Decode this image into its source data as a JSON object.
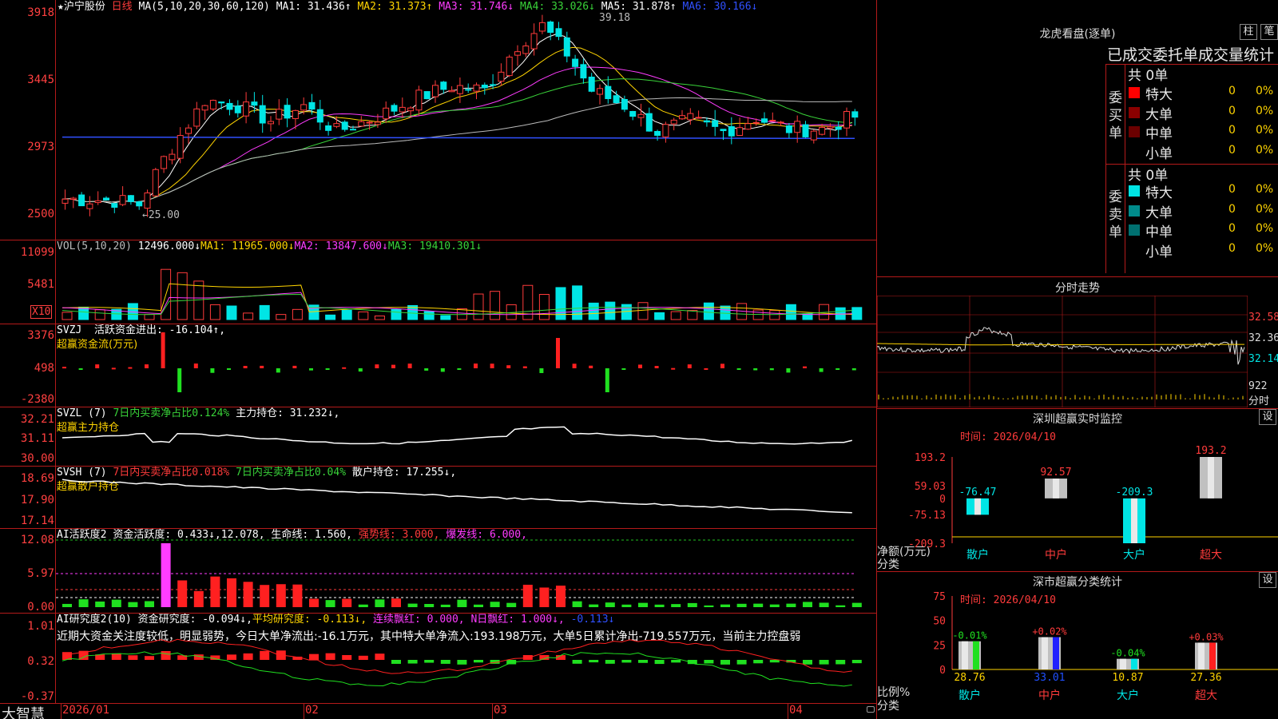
{
  "app": {
    "brand": "大智慧"
  },
  "stock": {
    "name": "沪宁股份",
    "period": "日线"
  },
  "main": {
    "ma_text": "MA(5,10,20,30,60,120)",
    "ma1": "MA1: 31.436↑",
    "ma2": "MA2: 31.373↑",
    "ma3": "MA3: 31.746↓",
    "ma4": "MA4: 33.026↓",
    "ma5": "MA5: 31.878↑",
    "ma6": "MA6: 30.166↓",
    "y_labels": [
      "3918",
      "3445",
      "2973",
      "2500"
    ],
    "high_mark": "39.18",
    "low_mark": "←25.00"
  },
  "vol": {
    "head": "VOL(5,10,20)",
    "val": "12496.000↓",
    "ma1": "MA1: 11965.000↓",
    "ma2": "MA2: 13847.600↓",
    "ma3": "MA3: 19410.301↓",
    "y_labels": [
      "11099",
      "5481"
    ],
    "unit": "X10"
  },
  "svzj": {
    "head": "SVZJ",
    "text": "活跃资金进出: -16.104↑,",
    "sub": "超赢资金流(万元)",
    "y_labels": [
      "3376",
      "498",
      "-2380"
    ]
  },
  "svzl": {
    "head": "SVZL (7)",
    "ratio": "7日内买卖净占比0.124%",
    "hold": "主力持仓: 31.232↓,",
    "sub": "超赢主力持仓",
    "y_labels": [
      "32.21",
      "31.11",
      "30.00"
    ]
  },
  "svsh": {
    "head": "SVSH (7)",
    "ratio1": "7日内买卖净占比0.018%",
    "ratio2": "7日内买卖净占比0.04%",
    "hold": "散户持仓: 17.255↓,",
    "sub": "超赢散户持仓",
    "y_labels": [
      "18.69",
      "17.90",
      "17.14"
    ]
  },
  "ai1": {
    "head": "AI活跃度2",
    "active": "资金活跃度: 0.433↓,",
    "v2": "12.078,",
    "life": "生命线: 1.560,",
    "strong": "强势线: 3.000,",
    "burst": "爆发线: 6.000,",
    "y_labels": [
      "12.08",
      "5.97",
      "0.00"
    ]
  },
  "ai2": {
    "head": "AI研究度2(10)",
    "research": "资金研究度: -0.094↓,",
    "avg": "平均研究度: -0.113↓,",
    "cont": "连续飘红: 0.000,",
    "nday": "N日飘红: 1.000↓,",
    "last": "-0.113↓",
    "summary": "近期大资金关注度较低，明显弱势，今日大单净流出:-16.1万元，其中特大单净流入:193.198万元，大单5日累计净出-719.557万元，当前主力控盘弱",
    "y_labels": [
      "1.01",
      "0.32",
      "-0.37"
    ]
  },
  "dates": [
    "2026/01",
    "02",
    "03",
    "04"
  ],
  "lhb": {
    "title": "龙虎看盘(逐单)",
    "btn1": "柱",
    "btn2": "笔",
    "subtitle": "已成交委托单成交量统计",
    "buy_side": "委买单",
    "sell_side": "委卖单",
    "buy": {
      "total": "共 0单",
      "rows": [
        {
          "label": "特大",
          "v": "0",
          "p": "0%",
          "color": "#ff0000"
        },
        {
          "label": "大单",
          "v": "0",
          "p": "0%",
          "color": "#8b0000"
        },
        {
          "label": "中单",
          "v": "0",
          "p": "0%",
          "color": "#6b0000"
        },
        {
          "label": "小单",
          "v": "0",
          "p": "0%",
          "color": "#000000"
        }
      ]
    },
    "sell": {
      "total": "共 0单",
      "rows": [
        {
          "label": "特大",
          "v": "0",
          "p": "0%",
          "color": "#00e5e5"
        },
        {
          "label": "大单",
          "v": "0",
          "p": "0%",
          "color": "#008b8b"
        },
        {
          "label": "中单",
          "v": "0",
          "p": "0%",
          "color": "#007070"
        },
        {
          "label": "小单",
          "v": "0",
          "p": "0%",
          "color": "#000000"
        }
      ]
    }
  },
  "intraday": {
    "title": "分时走势",
    "y_labels": [
      "32.58",
      "32.36",
      "32.14"
    ],
    "vol_label": "922",
    "unit": "分时"
  },
  "monitor": {
    "title": "深圳超赢实时监控",
    "set": "设",
    "time": "时间: 2026/04/10",
    "y_labels": [
      "193.2",
      "59.03",
      "0",
      "-75.13",
      "-209.3"
    ],
    "ylabel": "净额(万元)",
    "xlabel": "分类",
    "categories": [
      "散户",
      "中户",
      "大户",
      "超大"
    ],
    "values": [
      "-76.47",
      "92.57",
      "-209.3",
      "193.2"
    ]
  },
  "classify": {
    "title": "深市超赢分类统计",
    "set": "设",
    "time": "时间: 2026/04/10",
    "y_labels": [
      "75",
      "50",
      "25",
      "0"
    ],
    "ylabel": "比例%",
    "xlabel": "分类",
    "categories": [
      "散户",
      "中户",
      "大户",
      "超大"
    ],
    "changes": [
      "-0.01%",
      "+0.02%",
      "-0.04%",
      "+0.03%"
    ],
    "values": [
      "28.76",
      "33.01",
      "10.87",
      "27.36"
    ]
  },
  "chart_data": {
    "type": "bar",
    "categories": [
      "散户",
      "中户",
      "大户",
      "超大"
    ],
    "series": [
      {
        "name": "净额(万元)",
        "values": [
          -76.47,
          92.57,
          -209.3,
          193.2
        ]
      },
      {
        "name": "比例%",
        "values": [
          28.76,
          33.01,
          10.87,
          27.36
        ]
      }
    ]
  }
}
